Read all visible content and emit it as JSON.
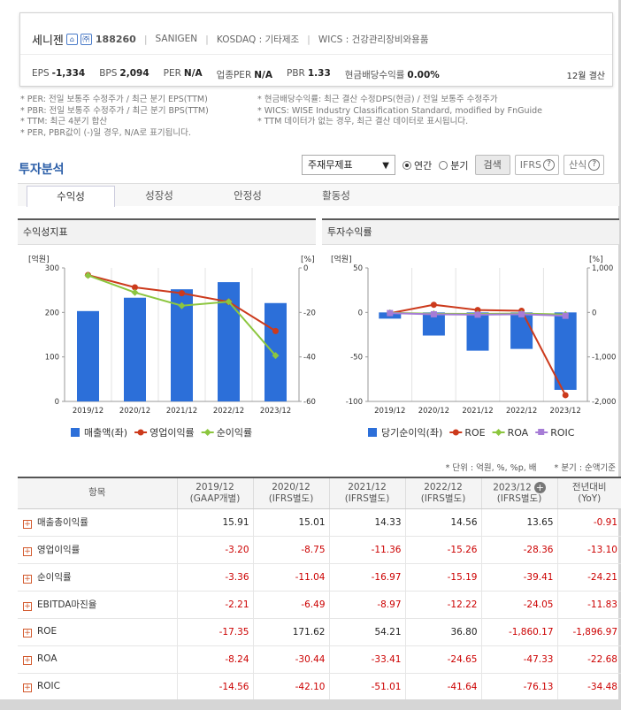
{
  "header": {
    "company": "세니젠",
    "icon1": "⌂",
    "icon2": "㈜",
    "code": "188260",
    "eng_name": "SANIGEN",
    "market": "KOSDAQ : 기타제조",
    "wics": "WICS : 건강관리장비와용품",
    "metrics": [
      {
        "label": "EPS",
        "value": "-1,334"
      },
      {
        "label": "BPS",
        "value": "2,094"
      },
      {
        "label": "PER",
        "value": "N/A"
      },
      {
        "label": "업종PER",
        "value": "N/A"
      },
      {
        "label": "PBR",
        "value": "1.33"
      },
      {
        "label": "현금배당수익률",
        "value": "0.00%"
      }
    ],
    "settlement": "12월 결산"
  },
  "notes": {
    "left": [
      "* PER: 전일 보통주 수정주가 / 최근 분기 EPS(TTM)",
      "* PBR: 전일 보통주 수정주가 / 최근 분기 BPS(TTM)",
      "* TTM: 최근 4분기 합산",
      "* PER, PBR값이 (-)일 경우, N/A로 표기됩니다."
    ],
    "right": [
      "* 현금배당수익률: 최근 결산 수정DPS(현금) / 전일 보통주 수정주가",
      "* WICS: WISE Industry Classification Standard, modified by FnGuide",
      "* TTM 데이터가 없는 경우, 최근 결산 데이터로 표시됩니다."
    ]
  },
  "section_title": "투자분석",
  "controls": {
    "select": "주재무제표",
    "radio_annual": "연간",
    "radio_quarter": "분기",
    "search_btn": "검색",
    "ifrs_btn": "IFRS",
    "formula_btn": "산식"
  },
  "tabs": [
    "수익성",
    "성장성",
    "안정성",
    "활동성"
  ],
  "panels": {
    "left": "수익성지표",
    "right": "투자수익률"
  },
  "chart_data": [
    {
      "type": "bar",
      "categories": [
        "2019/12",
        "2020/12",
        "2021/12",
        "2022/12",
        "2023/12"
      ],
      "left_unit": "[억원]",
      "right_unit": "[%]",
      "ylim_left": [
        0,
        300
      ],
      "ylim_right": [
        -60,
        0
      ],
      "left_ticks": [
        "300",
        "200",
        "100",
        "0"
      ],
      "right_ticks": [
        "0",
        "-20",
        "-40",
        "-60"
      ],
      "series": [
        {
          "name": "매출액(좌)",
          "type": "bar",
          "axis": "left",
          "color": "#2c6fd9",
          "values": [
            203,
            233,
            252,
            268,
            221
          ]
        },
        {
          "name": "영업이익률",
          "type": "line",
          "axis": "right",
          "color": "#cc3a1c",
          "values": [
            -3.2,
            -8.75,
            -11.36,
            -15.26,
            -28.36
          ]
        },
        {
          "name": "순이익률",
          "type": "line",
          "axis": "right",
          "color": "#8cc63f",
          "values": [
            -3.36,
            -11.04,
            -16.97,
            -15.19,
            -39.41
          ]
        }
      ]
    },
    {
      "type": "bar",
      "categories": [
        "2019/12",
        "2020/12",
        "2021/12",
        "2022/12",
        "2023/12"
      ],
      "left_unit": "[억원]",
      "right_unit": "[%]",
      "ylim_left": [
        -100,
        50
      ],
      "ylim_right": [
        -2000,
        1000
      ],
      "left_ticks": [
        "50",
        "0",
        "-50",
        "-100"
      ],
      "right_ticks": [
        "1,000",
        "0",
        "-1,000",
        "-2,000"
      ],
      "series": [
        {
          "name": "당기순이익(좌)",
          "type": "bar",
          "axis": "left",
          "color": "#2c6fd9",
          "values": [
            -7,
            -26,
            -43,
            -41,
            -87
          ]
        },
        {
          "name": "ROE",
          "type": "line",
          "axis": "right",
          "color": "#cc3a1c",
          "values": [
            -17.35,
            171.62,
            54.21,
            36.8,
            -1860.17
          ]
        },
        {
          "name": "ROA",
          "type": "line",
          "axis": "right",
          "color": "#8cc63f",
          "values": [
            -8.24,
            -30.44,
            -33.41,
            -24.65,
            -47.33
          ]
        },
        {
          "name": "ROIC",
          "type": "line",
          "axis": "right",
          "color": "#a67cd6",
          "values": [
            -14.56,
            -42.1,
            -51.01,
            -41.64,
            -76.13
          ]
        }
      ]
    }
  ],
  "unit_note": "* 단위 : 억원, %, %p, 배",
  "quarter_note": "* 분기 : 순액기준",
  "table": {
    "headers": [
      {
        "line1": "항목",
        "line2": ""
      },
      {
        "line1": "2019/12",
        "line2": "(GAAP개별)"
      },
      {
        "line1": "2020/12",
        "line2": "(IFRS별도)"
      },
      {
        "line1": "2021/12",
        "line2": "(IFRS별도)"
      },
      {
        "line1": "2022/12",
        "line2": "(IFRS별도)"
      },
      {
        "line1": "2023/12",
        "line2": "(IFRS별도)"
      },
      {
        "line1": "전년대비",
        "line2": "(YoY)"
      }
    ],
    "rows": [
      {
        "label": "매출총이익률",
        "values": [
          "15.91",
          "15.01",
          "14.33",
          "14.56",
          "13.65",
          "-0.91"
        ]
      },
      {
        "label": "영업이익률",
        "values": [
          "-3.20",
          "-8.75",
          "-11.36",
          "-15.26",
          "-28.36",
          "-13.10"
        ]
      },
      {
        "label": "순이익률",
        "values": [
          "-3.36",
          "-11.04",
          "-16.97",
          "-15.19",
          "-39.41",
          "-24.21"
        ]
      },
      {
        "label": "EBITDA마진율",
        "values": [
          "-2.21",
          "-6.49",
          "-8.97",
          "-12.22",
          "-24.05",
          "-11.83"
        ]
      },
      {
        "label": "ROE",
        "values": [
          "-17.35",
          "171.62",
          "54.21",
          "36.80",
          "-1,860.17",
          "-1,896.97"
        ]
      },
      {
        "label": "ROA",
        "values": [
          "-8.24",
          "-30.44",
          "-33.41",
          "-24.65",
          "-47.33",
          "-22.68"
        ]
      },
      {
        "label": "ROIC",
        "values": [
          "-14.56",
          "-42.10",
          "-51.01",
          "-41.64",
          "-76.13",
          "-34.48"
        ]
      }
    ]
  }
}
